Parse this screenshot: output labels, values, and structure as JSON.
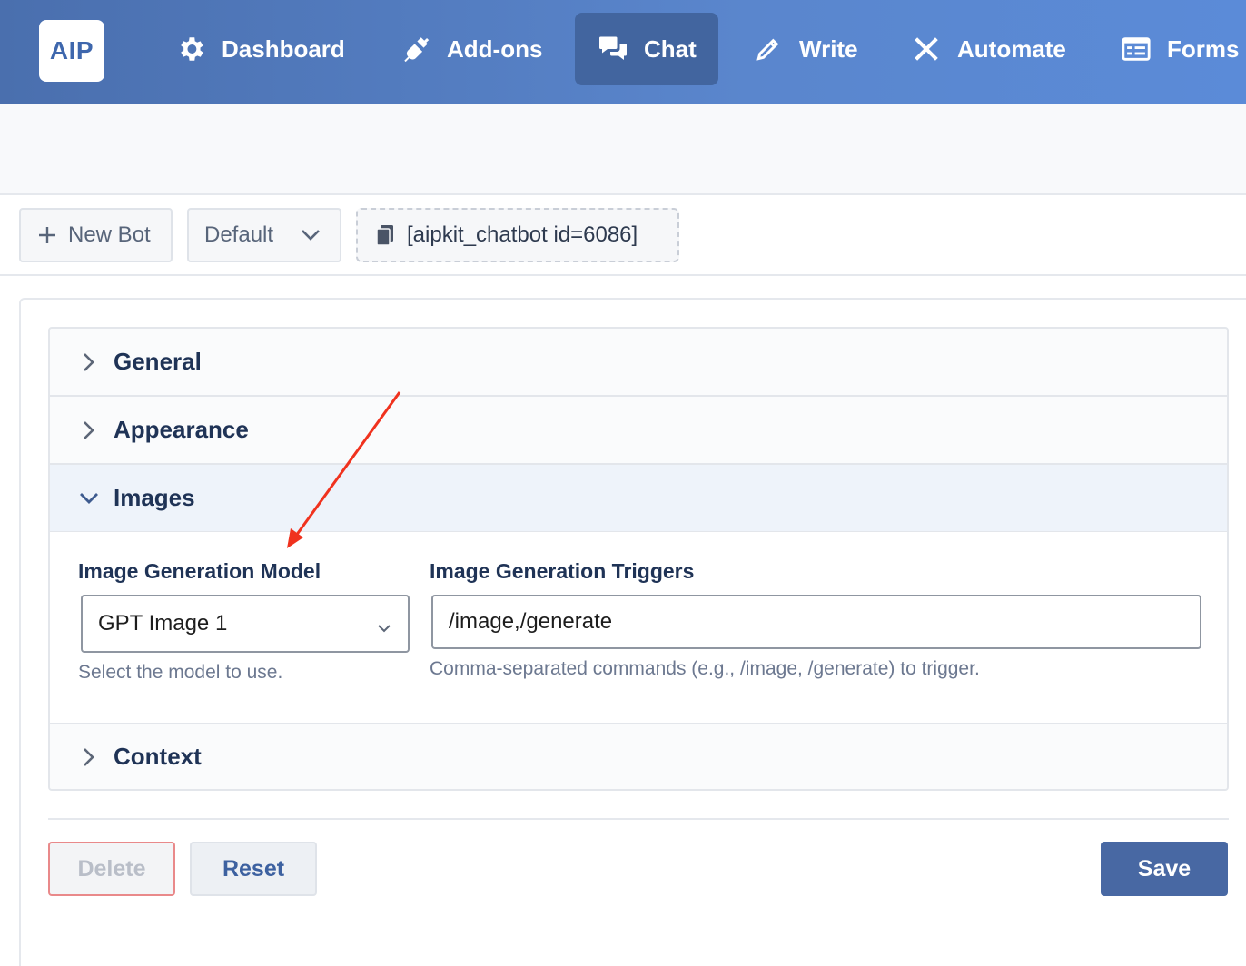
{
  "brand": {
    "logo_text": "AIP"
  },
  "nav": {
    "items": [
      {
        "label": "Dashboard",
        "icon": "gear-icon"
      },
      {
        "label": "Add-ons",
        "icon": "plug-icon"
      },
      {
        "label": "Chat",
        "icon": "chat-bubbles-icon",
        "active": true
      },
      {
        "label": "Write",
        "icon": "pencil-icon"
      },
      {
        "label": "Automate",
        "icon": "tools-icon"
      },
      {
        "label": "Forms",
        "icon": "form-icon"
      }
    ]
  },
  "toolbar": {
    "new_bot_label": "New Bot",
    "bot_select_value": "Default",
    "shortcode": "[aipkit_chatbot id=6086]"
  },
  "accordion": {
    "sections": [
      {
        "label": "General",
        "open": false
      },
      {
        "label": "Appearance",
        "open": false
      },
      {
        "label": "Images",
        "open": true
      },
      {
        "label": "Context",
        "open": false
      }
    ]
  },
  "images": {
    "model_label": "Image Generation Model",
    "model_value": "GPT Image 1",
    "model_help": "Select the model to use.",
    "triggers_label": "Image Generation Triggers",
    "triggers_value": "/image,/generate",
    "triggers_help": "Comma-separated commands (e.g., /image, /generate) to trigger."
  },
  "footer": {
    "delete_label": "Delete",
    "reset_label": "Reset",
    "save_label": "Save"
  },
  "colors": {
    "nav_gradient_start": "#4a6fae",
    "nav_gradient_end": "#5b8bd8",
    "primary": "#4868a3",
    "annotation_arrow": "#f0321e"
  }
}
